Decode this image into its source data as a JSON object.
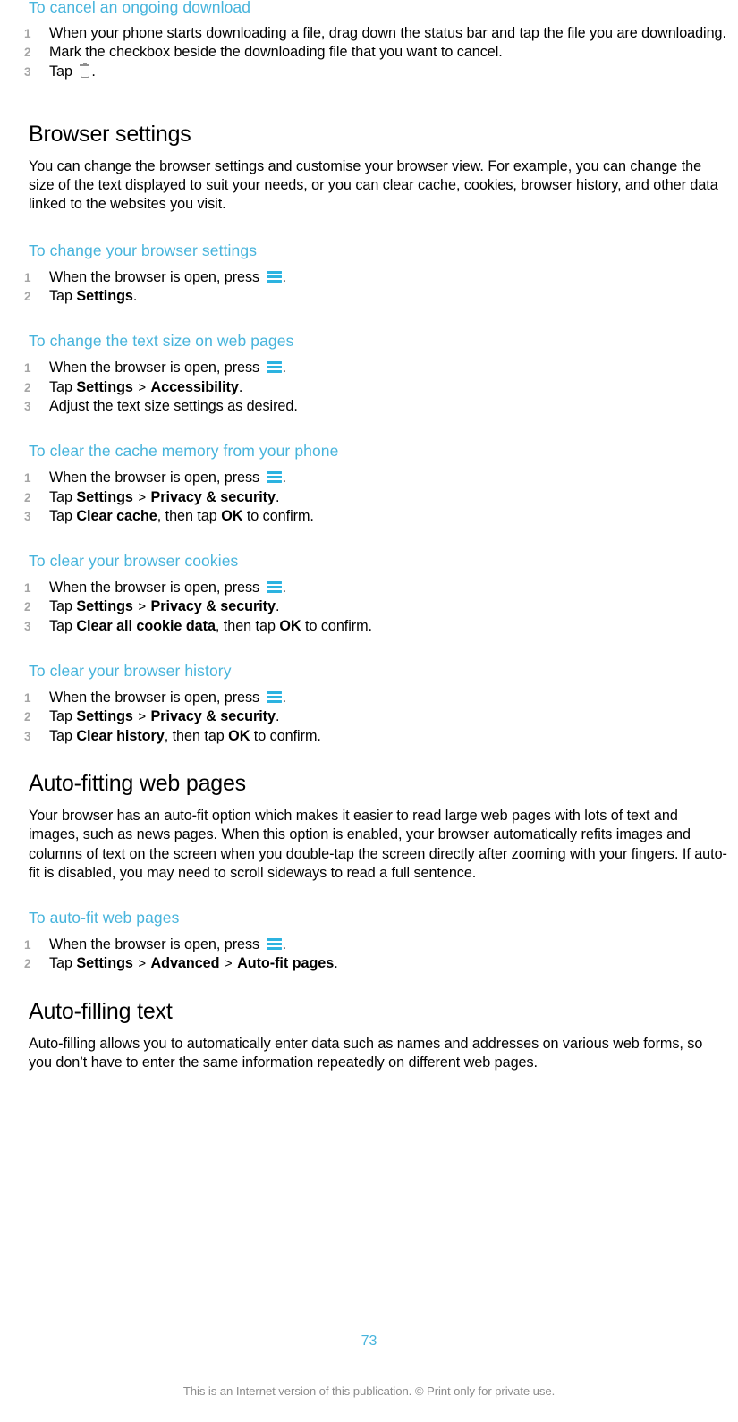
{
  "document": {
    "page_number": "73",
    "footer_note": "This is an Internet version of this publication. © Print only for private use.",
    "accent_color": "#47b4dc",
    "step_number_color": "#a6a6a6",
    "icons": {
      "menu": "menu-icon",
      "trash": "trash-icon"
    }
  },
  "sections": [
    {
      "id": "cancel-download",
      "type": "procedure",
      "heading": "To cancel an ongoing download",
      "steps": [
        {
          "pre": "When your phone starts downloading a file, drag down the status bar and tap the file you are downloading."
        },
        {
          "pre": "Mark the checkbox beside the downloading file that you want to cancel."
        },
        {
          "pre": "Tap ",
          "icon": "trash-icon",
          "post": "."
        }
      ]
    },
    {
      "id": "browser-settings",
      "type": "topic",
      "heading": "Browser settings",
      "body": "You can change the browser settings and customise your browser view. For example, you can change the size of the text displayed to suit your needs, or you can clear cache, cookies, browser history, and other data linked to the websites you visit."
    },
    {
      "id": "change-browser-settings",
      "type": "procedure",
      "heading": "To change your browser settings",
      "steps": [
        {
          "pre": "When the browser is open, press ",
          "icon": "menu-icon",
          "post": "."
        },
        {
          "pre": "Tap ",
          "bold1": "Settings",
          "post": "."
        }
      ]
    },
    {
      "id": "change-text-size",
      "type": "procedure",
      "heading": "To change the text size on web pages",
      "steps": [
        {
          "pre": "When the browser is open, press ",
          "icon": "menu-icon",
          "post": "."
        },
        {
          "pre": "Tap ",
          "bold1": "Settings",
          "sep1": ">",
          "bold2": "Accessibility",
          "post": "."
        },
        {
          "pre": "Adjust the text size settings as desired."
        }
      ]
    },
    {
      "id": "clear-cache",
      "type": "procedure",
      "heading": "To clear the cache memory from your phone",
      "steps": [
        {
          "pre": "When the browser is open, press ",
          "icon": "menu-icon",
          "post": "."
        },
        {
          "pre": "Tap ",
          "bold1": "Settings",
          "sep1": ">",
          "bold2": "Privacy & security",
          "post": "."
        },
        {
          "pre": "Tap ",
          "bold1": "Clear cache",
          "mid": ", then tap ",
          "bold2": "OK",
          "post": " to confirm."
        }
      ]
    },
    {
      "id": "clear-cookies",
      "type": "procedure",
      "heading": "To clear your browser cookies",
      "steps": [
        {
          "pre": "When the browser is open, press ",
          "icon": "menu-icon",
          "post": "."
        },
        {
          "pre": "Tap ",
          "bold1": "Settings",
          "sep1": ">",
          "bold2": "Privacy & security",
          "post": "."
        },
        {
          "pre": "Tap ",
          "bold1": "Clear all cookie data",
          "mid": ", then tap ",
          "bold2": "OK",
          "post": " to confirm."
        }
      ]
    },
    {
      "id": "clear-history",
      "type": "procedure",
      "heading": "To clear your browser history",
      "steps": [
        {
          "pre": "When the browser is open, press ",
          "icon": "menu-icon",
          "post": "."
        },
        {
          "pre": "Tap ",
          "bold1": "Settings",
          "sep1": ">",
          "bold2": "Privacy & security",
          "post": "."
        },
        {
          "pre": "Tap ",
          "bold1": "Clear history",
          "mid": ", then tap ",
          "bold2": "OK",
          "post": " to confirm."
        }
      ]
    },
    {
      "id": "auto-fitting",
      "type": "topic",
      "heading": "Auto-fitting web pages",
      "body": "Your browser has an auto-fit option which makes it easier to read large web pages with lots of text and images, such as news pages. When this option is enabled, your browser automatically refits images and columns of text on the screen when you double-tap the screen directly after zooming with your fingers. If auto-fit is disabled, you may need to scroll sideways to read a full sentence."
    },
    {
      "id": "auto-fit-web-pages",
      "type": "procedure",
      "heading": "To auto-fit web pages",
      "steps": [
        {
          "pre": "When the browser is open, press ",
          "icon": "menu-icon",
          "post": "."
        },
        {
          "pre": "Tap ",
          "bold1": "Settings",
          "sep1": ">",
          "bold2": "Advanced",
          "sep2": ">",
          "bold3": "Auto-fit pages",
          "post": "."
        }
      ]
    },
    {
      "id": "auto-filling",
      "type": "topic",
      "heading": "Auto-filling text",
      "body": "Auto-filling allows you to automatically enter data such as names and addresses on various web forms, so you don’t have to enter the same information repeatedly on different web pages."
    }
  ]
}
